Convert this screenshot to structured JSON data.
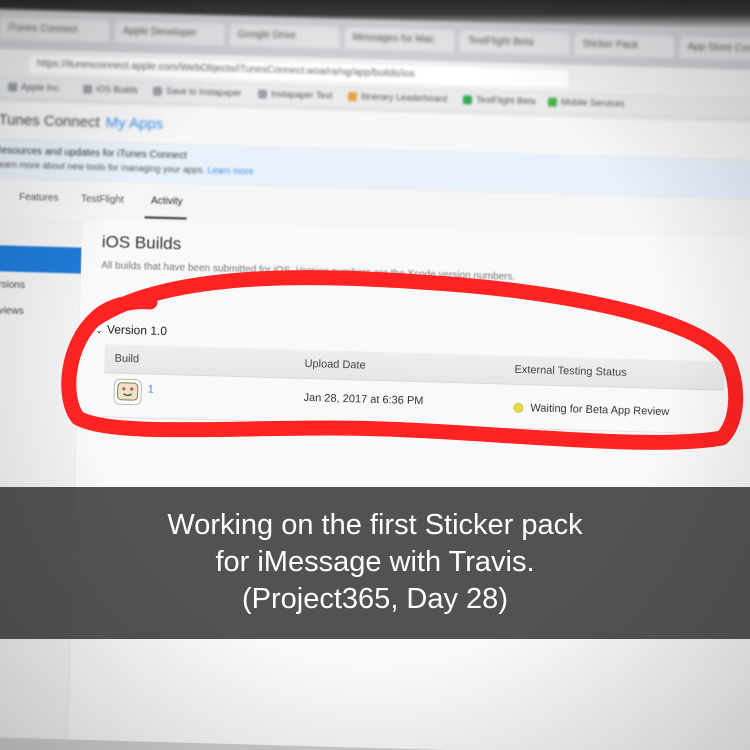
{
  "browser": {
    "tabs": [
      "iTunes Connect",
      "Apple Developer",
      "Google Drive",
      "Messages for Mac",
      "TestFlight Beta",
      "Sticker Pack",
      "App Store Connect"
    ],
    "url": "https://itunesconnect.apple.com/WebObjects/iTunesConnect.woa/ra/ng/app/builds/ios",
    "bookmarks": [
      "Apple Inc.",
      "iOS Builds",
      "Save to Instapaper",
      "Instapaper Text",
      "Itinerary Leaderboard",
      "TestFlight Beta",
      "Mobile Services"
    ],
    "bookmark_colors": [
      "#9aa0a6",
      "#9aa0a6",
      "#9aa0a6",
      "#9aa0a6",
      "#e8a33d",
      "#33a852",
      "#4caf50"
    ]
  },
  "app_header": {
    "brand": "iTunes Connect",
    "section": "My Apps"
  },
  "banner": {
    "line1": "Resources and updates for iTunes Connect",
    "line2": "Learn more about new tools for managing your apps.",
    "link": "Learn more"
  },
  "nav_tabs": [
    "Features",
    "TestFlight",
    "Activity"
  ],
  "active_tab": "Activity",
  "sidebar": {
    "items": [
      "Versions",
      "Reviews"
    ]
  },
  "page": {
    "title": "iOS Builds",
    "subtitle": "All builds that have been submitted for iOS. Version numbers are the Xcode version numbers."
  },
  "version_group": {
    "label": "Version 1.0",
    "columns": [
      "Build",
      "Upload Date",
      "External Testing Status"
    ],
    "rows": [
      {
        "build": "1",
        "upload_date": "Jan 28, 2017 at 6:36 PM",
        "status": "Waiting for Beta App Review"
      }
    ]
  },
  "annotation": {
    "color": "#ff1a1a"
  },
  "caption": {
    "line1": "Working on the first Sticker pack",
    "line2": "for iMessage with Travis.",
    "line3": "(Project365, Day 28)"
  }
}
